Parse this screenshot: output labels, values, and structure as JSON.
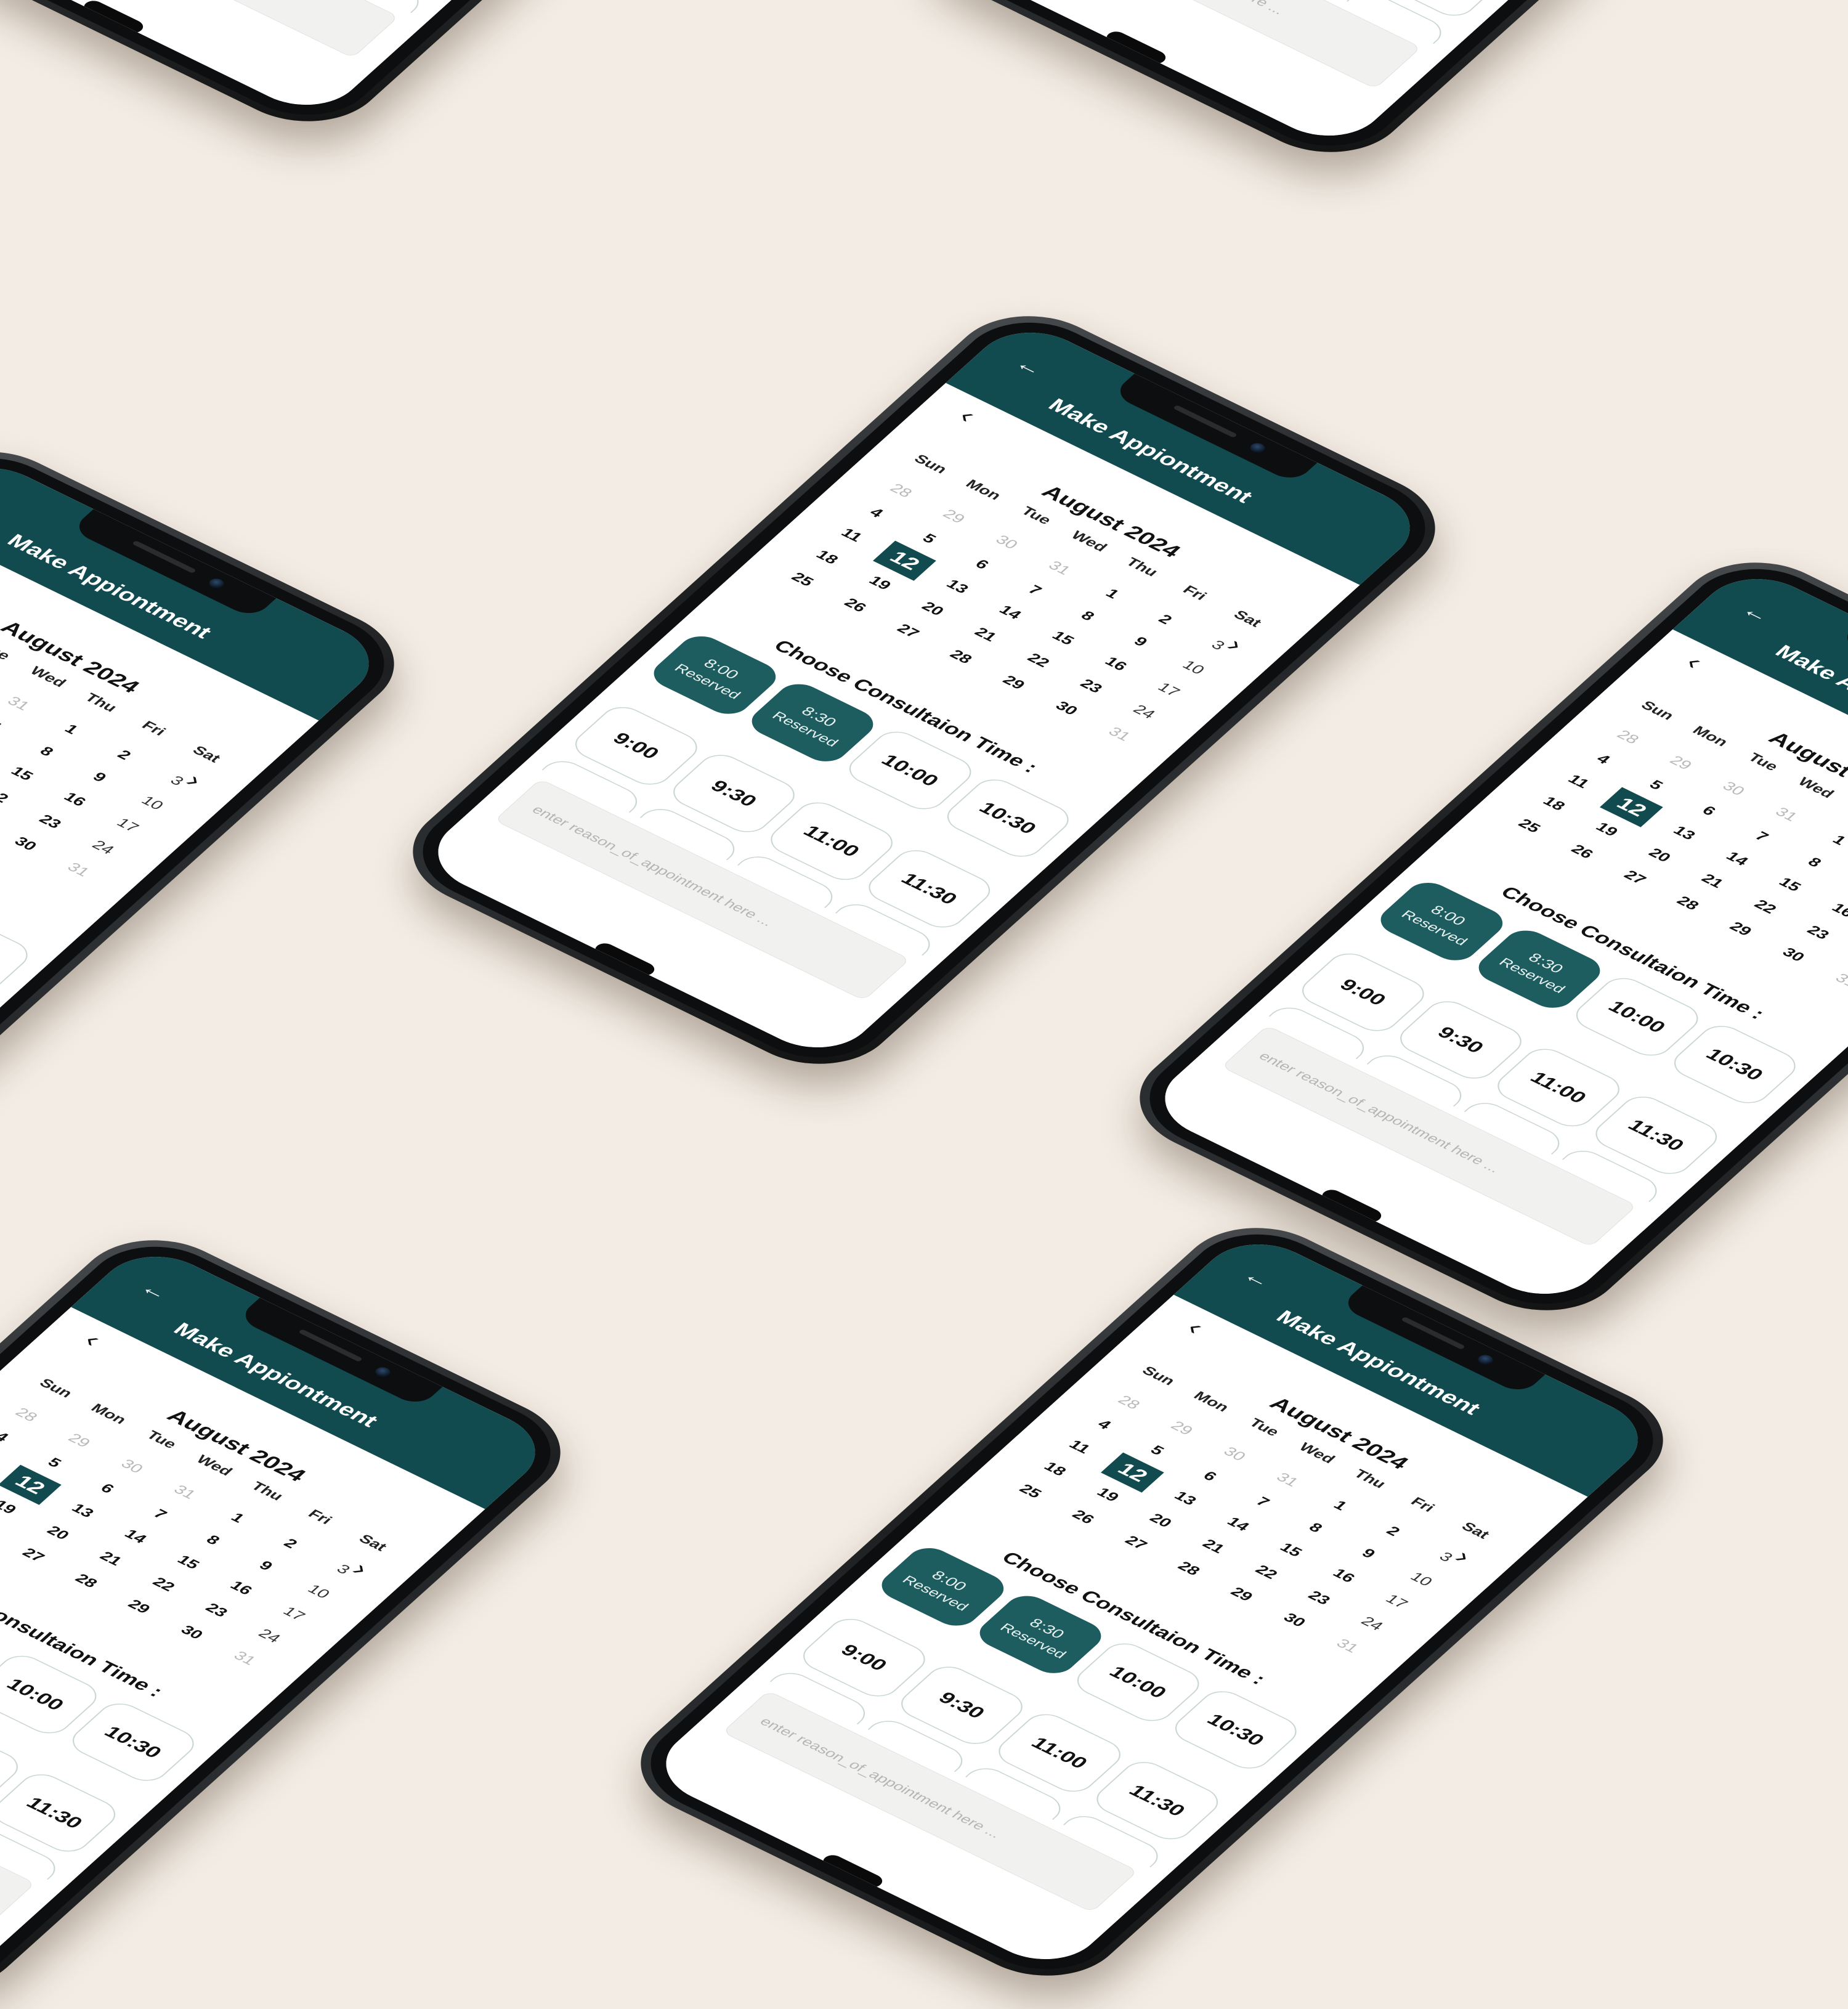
{
  "app": {
    "back_icon": "arrow-left-icon",
    "title": "Make Appiontment"
  },
  "calendar": {
    "prev_icon": "chevron-left-icon",
    "next_icon": "chevron-right-icon",
    "month_title": "August 2024",
    "weekdays": [
      "Sun",
      "Mon",
      "Tue",
      "Wed",
      "Thu",
      "Fri",
      "Sat"
    ],
    "days": [
      {
        "n": "28",
        "muted": true
      },
      {
        "n": "29",
        "muted": true
      },
      {
        "n": "30",
        "muted": true
      },
      {
        "n": "31",
        "muted": true
      },
      {
        "n": "1"
      },
      {
        "n": "2"
      },
      {
        "n": "3",
        "sat": true
      },
      {
        "n": "4"
      },
      {
        "n": "5"
      },
      {
        "n": "6"
      },
      {
        "n": "7"
      },
      {
        "n": "8"
      },
      {
        "n": "9"
      },
      {
        "n": "10",
        "sat": true
      },
      {
        "n": "11"
      },
      {
        "n": "12",
        "selected": true
      },
      {
        "n": "13"
      },
      {
        "n": "14"
      },
      {
        "n": "15"
      },
      {
        "n": "16"
      },
      {
        "n": "17",
        "sat": true
      },
      {
        "n": "18"
      },
      {
        "n": "19"
      },
      {
        "n": "20"
      },
      {
        "n": "21"
      },
      {
        "n": "22"
      },
      {
        "n": "23"
      },
      {
        "n": "24",
        "sat": true
      },
      {
        "n": "25"
      },
      {
        "n": "26"
      },
      {
        "n": "27"
      },
      {
        "n": "28"
      },
      {
        "n": "29"
      },
      {
        "n": "30"
      },
      {
        "n": "31",
        "muted": true
      }
    ],
    "selected_day": "12"
  },
  "consultation": {
    "title": "Choose Consultaion Time :",
    "slots": [
      {
        "time": "8:00",
        "status": "Reserved",
        "reserved": true
      },
      {
        "time": "8:30",
        "status": "Reserved",
        "reserved": true
      },
      {
        "time": "10:00"
      },
      {
        "time": "10:30"
      },
      {
        "time": "9:00"
      },
      {
        "time": "9:30"
      },
      {
        "time": "11:00"
      },
      {
        "time": "11:30"
      }
    ]
  },
  "reason": {
    "placeholder": "enter reason_of_appointment here ..."
  },
  "colors": {
    "primary": "#124b4f",
    "reserved": "#1d5c5f",
    "background": "#f3ece4"
  }
}
